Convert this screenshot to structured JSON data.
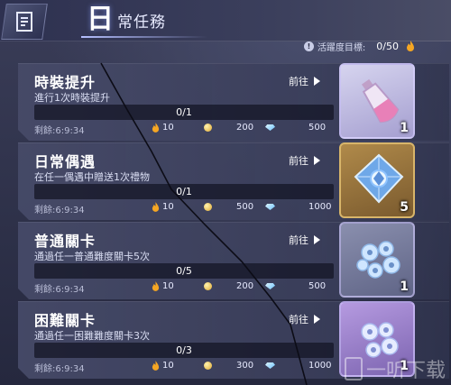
{
  "header": {
    "title_first_char": "日",
    "title_rest": "常任務",
    "activity_label": "活躍度目標:",
    "activity_value": "0/50"
  },
  "quests": [
    {
      "name": "時裝提升",
      "description": "進行1次時裝提升",
      "goto_label": "前往",
      "progress": "0/1",
      "remaining": "剩餘:6:9:34",
      "reward_activity": "10",
      "reward_gold": "200",
      "reward_gem": "500",
      "item_count": "1",
      "item_icon": "potion-bottle-icon"
    },
    {
      "name": "日常偶遇",
      "description": "在任一偶遇中贈送1次禮物",
      "goto_label": "前往",
      "progress": "0/1",
      "remaining": "剩餘:6:9:34",
      "reward_activity": "10",
      "reward_gold": "500",
      "reward_gem": "1000",
      "item_count": "5",
      "item_icon": "crystal-gem-icon"
    },
    {
      "name": "普通關卡",
      "description": "通過任一普通難度關卡5次",
      "goto_label": "前往",
      "progress": "0/5",
      "remaining": "剩餘:6:9:34",
      "reward_activity": "10",
      "reward_gold": "200",
      "reward_gem": "500",
      "item_count": "1",
      "item_icon": "flower-accessory-icon"
    },
    {
      "name": "困難關卡",
      "description": "通過任一困難難度關卡3次",
      "goto_label": "前往",
      "progress": "0/3",
      "remaining": "剩餘:6:9:34",
      "reward_activity": "10",
      "reward_gold": "300",
      "reward_gem": "1000",
      "item_count": "1",
      "item_icon": "flower-accessory-icon"
    }
  ],
  "watermark": {
    "text": "一听下载"
  },
  "colors": {
    "background": "#2a2d45",
    "card": "#464a68",
    "flame": "#f5a623",
    "gold": "#e0a930",
    "gem": "#6ec5ff"
  }
}
